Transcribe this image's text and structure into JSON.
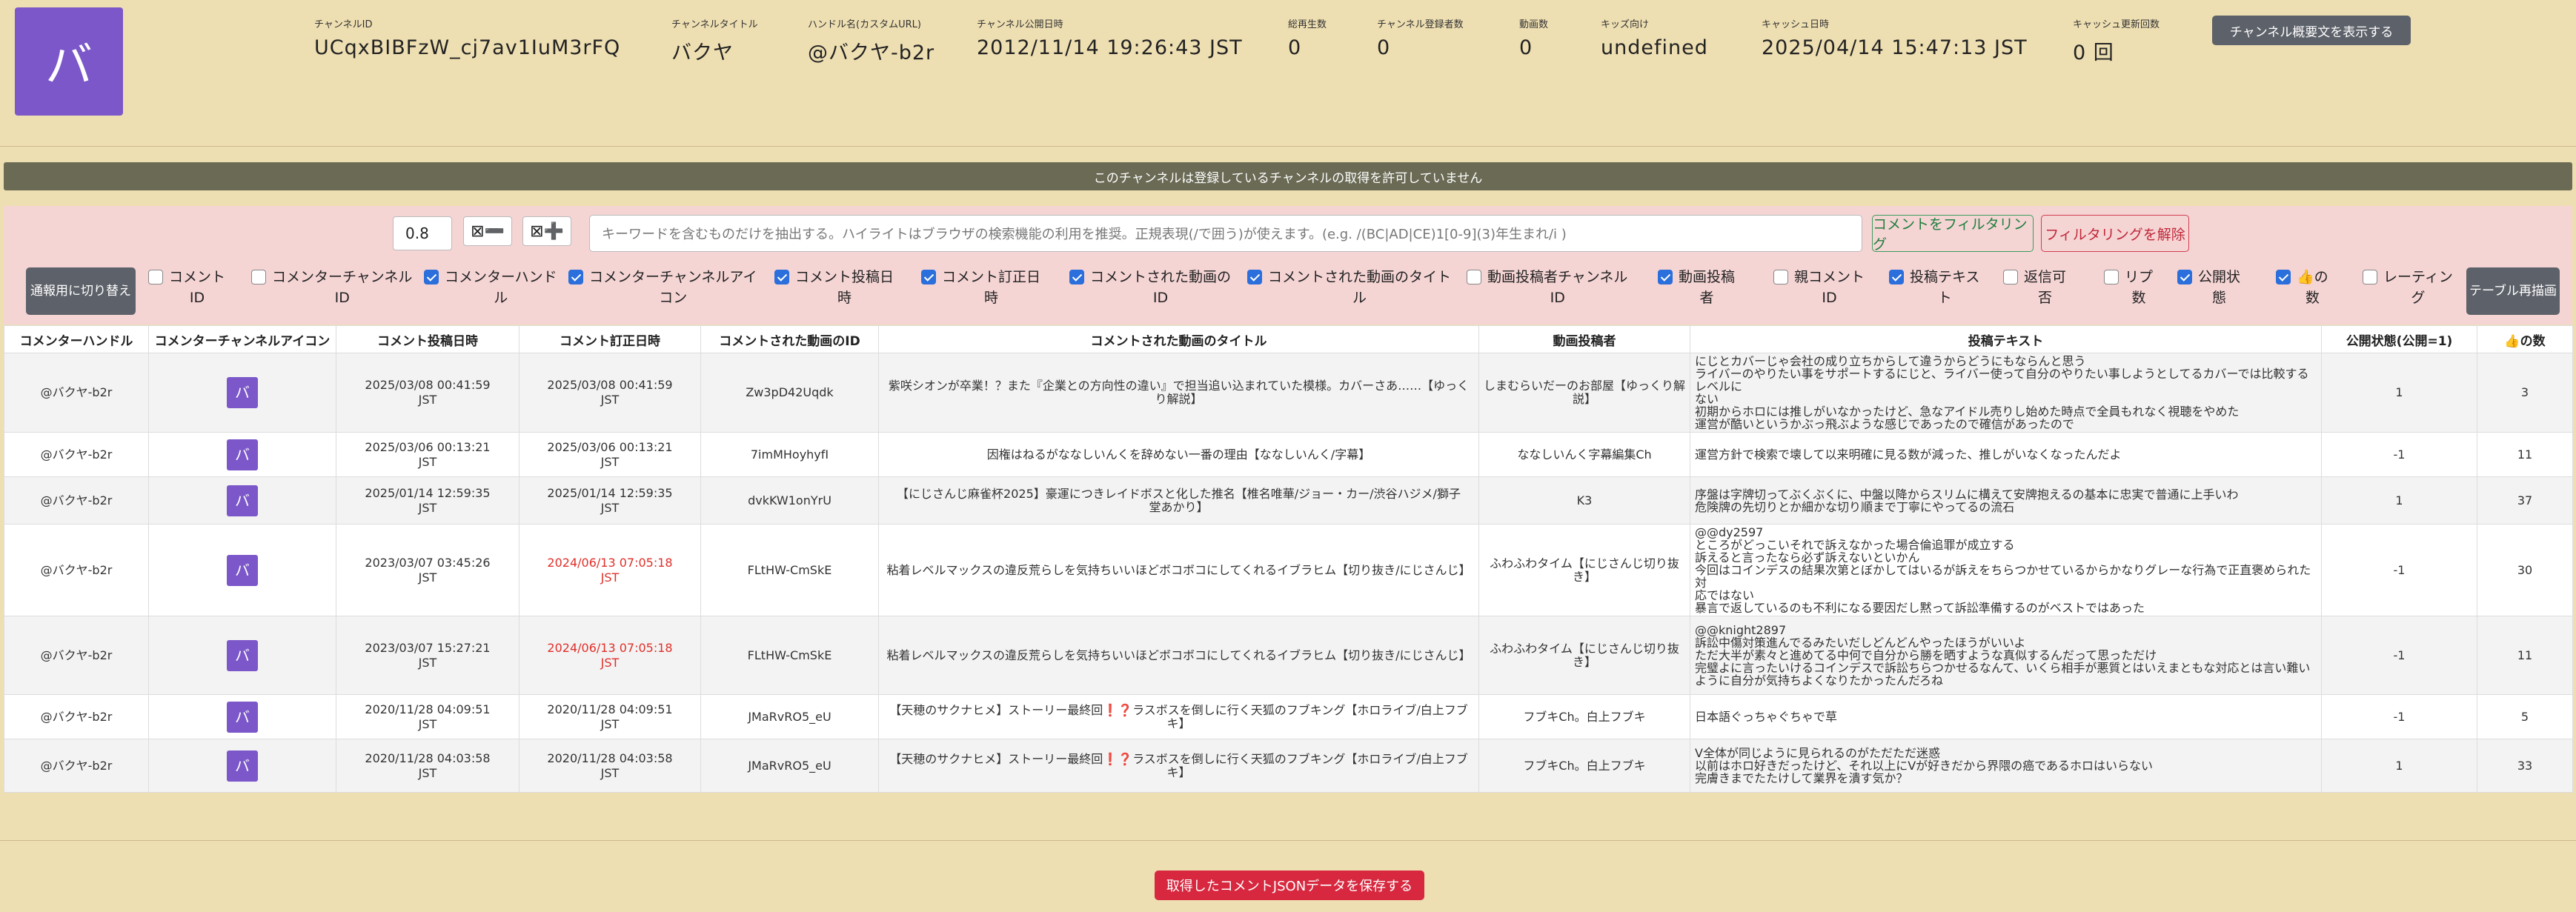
{
  "channel": {
    "avatar_char": "バ",
    "fields": [
      {
        "label": "チャンネルID",
        "value": "UCqxBIBFzW_cj7av1IuM3rFQ"
      },
      {
        "label": "チャンネルタイトル",
        "value": "バクヤ"
      },
      {
        "label": "ハンドル名(カスタムURL)",
        "value": "@バクヤ-b2r"
      },
      {
        "label": "チャンネル公開日時",
        "value": "2012/11/14 19:26:43 JST"
      },
      {
        "label": "総再生数",
        "value": "0"
      },
      {
        "label": "チャンネル登録者数",
        "value": "0"
      },
      {
        "label": "動画数",
        "value": "0"
      },
      {
        "label": "キッズ向け",
        "value": "undefined"
      },
      {
        "label": "キャッシュ日時",
        "value": "2025/04/14 15:47:13 JST"
      },
      {
        "label": "キャッシュ更新回数",
        "value": "0 回"
      }
    ],
    "summary_button": "チャンネル概要文を表示する"
  },
  "banner": "このチャンネルは登録しているチャンネルの取得を許可していません",
  "filter": {
    "threshold": "0.8",
    "zoom_out_label": "⊠➖",
    "zoom_in_label": "⊠➕",
    "search_placeholder": "キーワードを含むものだけを抽出する。ハイライトはブラウザの検索機能の利用を推奨。正規表現(/で囲う)が使えます。(e.g. /(BC|AD|CE)1[0-9](3)年生まれ/i )",
    "filter_button": "コメントをフィルタリング",
    "unfilter_button": "フィルタリングを解除",
    "switch_button": "通報用に切り替え",
    "redraw_button": "テーブル再描画"
  },
  "columns_toggle": [
    {
      "label": "コメント\nID",
      "checked": false
    },
    {
      "label": "コメンターチャンネル\nID",
      "checked": false
    },
    {
      "label": "コメンターハンド\nル",
      "checked": true
    },
    {
      "label": "コメンターチャンネルアイ\nコン",
      "checked": true
    },
    {
      "label": "コメント投稿日\n時",
      "checked": true
    },
    {
      "label": "コメント訂正日\n時",
      "checked": true
    },
    {
      "label": "コメントされた動画の\nID",
      "checked": true
    },
    {
      "label": "コメントされた動画のタイト\nル",
      "checked": true
    },
    {
      "label": "動画投稿者チャンネル\nID",
      "checked": false
    },
    {
      "label": "動画投稿\n者",
      "checked": true
    },
    {
      "label": "親コメント\nID",
      "checked": false
    },
    {
      "label": "投稿テキス\nト",
      "checked": true
    },
    {
      "label": "返信可\n否",
      "checked": false
    },
    {
      "label": "リプ\n数",
      "checked": false
    },
    {
      "label": "公開状\n態",
      "checked": true
    },
    {
      "label": "👍の\n数",
      "checked": true
    },
    {
      "label": "レーティン\nグ",
      "checked": false
    }
  ],
  "table": {
    "headers": [
      "コメンターハンドル",
      "コメンターチャンネルアイコン",
      "コメント投稿日時",
      "コメント訂正日時",
      "コメントされた動画のID",
      "コメントされた動画のタイトル",
      "動画投稿者",
      "投稿テキスト",
      "公開状態(公開=1)",
      "👍の数"
    ],
    "rows": [
      {
        "handle": "@バクヤ-b2r",
        "icon": "バ",
        "posted": "2025/03/08 00:41:59\nJST",
        "edited": "2025/03/08 00:41:59\nJST",
        "edited_red": false,
        "video_id": "Zw3pD42Uqdk",
        "video_title": "紫咲シオンが卒業！？また『企業との方向性の違い』で担当追い込まれていた模様。カバーさあ……【ゆっく\nり解説】",
        "uploader": "しまむらいだーのお部屋【ゆっくり解\n説】",
        "text": "にじとカバーじゃ会社の成り立ちからして違うからどうにもならんと思う\nライバーのやりたい事をサポートするにじと、ライバー使って自分のやりたい事しようとしてるカバーでは比較するレベルに\nない\n初期からホロには推しがいなかったけど、急なアイドル売りし始めた時点で全員もれなく視聴をやめた\n運営が酷いというかぶっ飛ぶような感じであったので確信があったので",
        "public": "1",
        "likes": "3"
      },
      {
        "handle": "@バクヤ-b2r",
        "icon": "バ",
        "posted": "2025/03/06 00:13:21\nJST",
        "edited": "2025/03/06 00:13:21\nJST",
        "edited_red": false,
        "video_id": "7imMHoyhyfI",
        "video_title": "因権はねるがななしいんくを辞めない一番の理由【ななしいんく/字幕】",
        "uploader": "ななしいんく字幕編集Ch",
        "text": "運営方針で検索で壊して以来明確に見る数が減った、推しがいなくなったんだよ",
        "public": "-1",
        "likes": "11"
      },
      {
        "handle": "@バクヤ-b2r",
        "icon": "バ",
        "posted": "2025/01/14 12:59:35\nJST",
        "edited": "2025/01/14 12:59:35\nJST",
        "edited_red": false,
        "video_id": "dvkKW1onYrU",
        "video_title": "【にじさんじ麻雀杯2025】豪運につきレイドボスと化した推名【椎名唯華/ジョー・カー/渋谷ハジメ/獅子\n堂あかり】",
        "uploader": "K3",
        "text": "序盤は字牌切ってぶくぶくに、中盤以降からスリムに構えて安牌抱えるの基本に忠実で普通に上手いわ\n危険牌の先切りとか細かな切り順まで丁寧にやってるの流石",
        "public": "1",
        "likes": "37"
      },
      {
        "handle": "@バクヤ-b2r",
        "icon": "バ",
        "posted": "2023/03/07 03:45:26\nJST",
        "edited": "2024/06/13 07:05:18\nJST",
        "edited_red": true,
        "video_id": "FLtHW-CmSkE",
        "video_title": "粘着レベルマックスの違反荒らしを気持ちいいほどボコボコにしてくれるイブラヒム【切り抜き/にじさんじ】",
        "uploader": "ふわふわタイム【にじさんじ切り抜き】",
        "text": "@@dy2597\nところがどっこいそれで訴えなかった場合倫追罪が成立する\n訴えると言ったなら必ず訴えないといかん\n今回はコインデスの結果次第とぼかしてはいるが訴えをちらつかせているからかなりグレーな行為で正直褒められた対\n応ではない\n暴言で返しているのも不利になる要因だし黙って訴訟準備するのがベストではあった",
        "public": "-1",
        "likes": "30"
      },
      {
        "handle": "@バクヤ-b2r",
        "icon": "バ",
        "posted": "2023/03/07 15:27:21\nJST",
        "edited": "2024/06/13 07:05:18\nJST",
        "edited_red": true,
        "video_id": "FLtHW-CmSkE",
        "video_title": "粘着レベルマックスの違反荒らしを気持ちいいほどボコボコにしてくれるイブラヒム【切り抜き/にじさんじ】",
        "uploader": "ふわふわタイム【にじさんじ切り抜き】",
        "text": "@@knight2897\n訴訟中傷対策進んでるみたいだしどんどんやったほうがいいよ\nただ大半が素々と進めてる中何で自分から勝を晒すような真似するんだって思っただけ\n完璧よに言ったいけるコインデスで訴訟ちらつかせるなんて、いくら相手が悪質とはいえまともな対応とは言い難い\nように自分が気持ちよくなりたかったんだろね",
        "public": "-1",
        "likes": "11"
      },
      {
        "handle": "@バクヤ-b2r",
        "icon": "バ",
        "posted": "2020/11/28 04:09:51\nJST",
        "edited": "2020/11/28 04:09:51\nJST",
        "edited_red": false,
        "video_id": "JMaRvRO5_eU",
        "video_title": "【天穂のサクナヒメ】ストーリー最終回❗❓ラスボスを倒しに行く天狐のフブキング【ホロライブ/白上フブキ】",
        "uploader": "フブキCh。白上フブキ",
        "text": "日本語ぐっちゃぐちゃで草",
        "public": "-1",
        "likes": "5"
      },
      {
        "handle": "@バクヤ-b2r",
        "icon": "バ",
        "posted": "2020/11/28 04:03:58\nJST",
        "edited": "2020/11/28 04:03:58\nJST",
        "edited_red": false,
        "video_id": "JMaRvRO5_eU",
        "video_title": "【天穂のサクナヒメ】ストーリー最終回❗❓ラスボスを倒しに行く天狐のフブキング【ホロライブ/白上フブキ】",
        "uploader": "フブキCh。白上フブキ",
        "text": "V全体が同じように見られるのがただただ迷惑\n以前はホロ好きだったけど、それ以上にVが好きだから界隈の癌であるホロはいらない\n完膚きまでたたけして業界を潰す気か？",
        "public": "1",
        "likes": "33"
      }
    ]
  },
  "save_button": "取得したコメントJSONデータを保存する"
}
